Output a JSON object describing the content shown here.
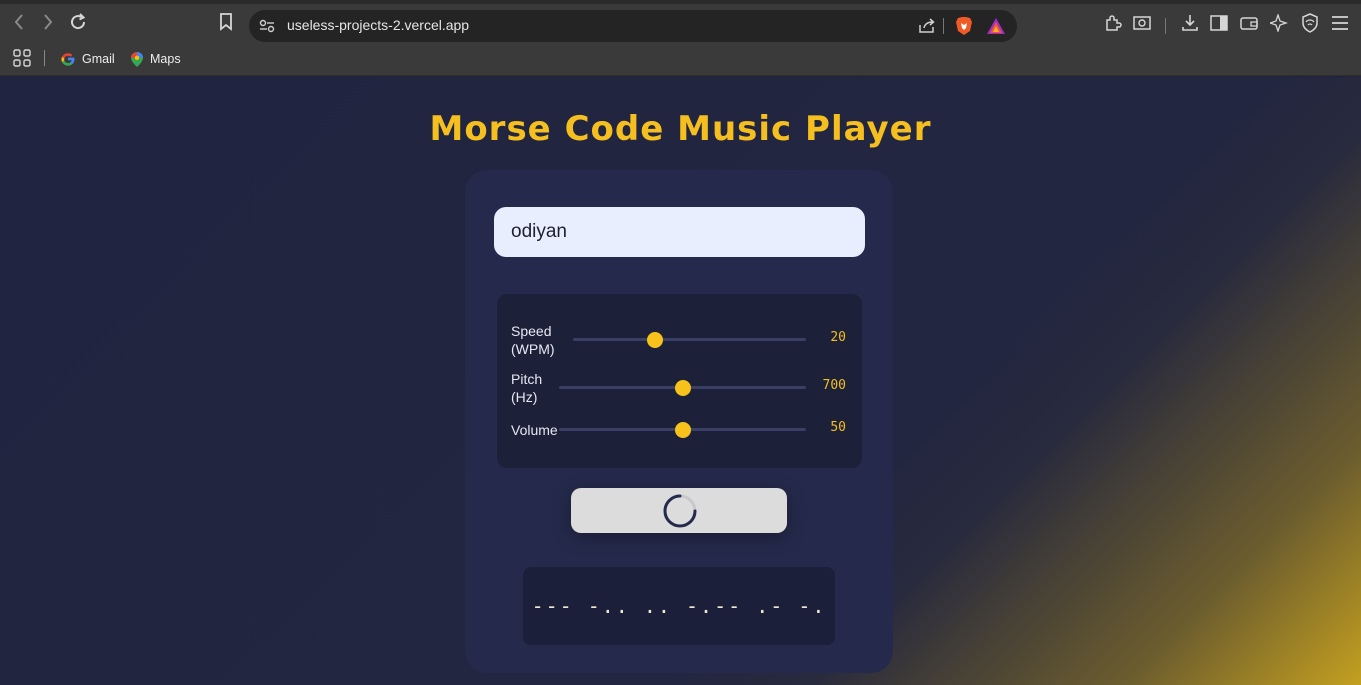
{
  "browser": {
    "url": "useless-projects-2.vercel.app",
    "bookmarks": [
      {
        "label": "Gmail",
        "icon": "google-icon"
      },
      {
        "label": "Maps",
        "icon": "maps-pin-icon"
      }
    ]
  },
  "app": {
    "title": "Morse Code Music Player",
    "input": {
      "value": "odiyan"
    },
    "controls": {
      "speed": {
        "label_line1": "Speed",
        "label_line2": "(WPM)",
        "value": "20",
        "level": 0.35
      },
      "pitch": {
        "label_line1": "Pitch",
        "label_line2": "(Hz)",
        "value": "700",
        "level": 0.5
      },
      "volume": {
        "label": "Volume",
        "value": "50",
        "level": 0.5
      }
    },
    "play_button": {
      "state": "loading"
    },
    "morse_output": "--- -.. .. -.-- .- -.",
    "colors": {
      "accent": "#f5bf1f",
      "card": "#252a4c",
      "background": "#212542"
    }
  }
}
